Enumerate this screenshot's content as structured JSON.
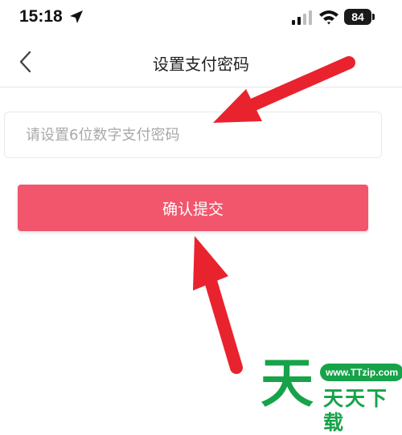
{
  "status_bar": {
    "time": "15:18",
    "battery": "84",
    "icons": [
      "location-arrow-icon",
      "cellular-signal-icon",
      "wifi-icon",
      "battery-icon"
    ]
  },
  "nav": {
    "back_icon": "chevron-left-icon",
    "title": "设置支付密码"
  },
  "form": {
    "password_placeholder": "请设置6位数字支付密码",
    "password_value": "",
    "submit_label": "确认提交"
  },
  "annotations": {
    "arrow_color": "#e8232e",
    "arrow_count": 2
  },
  "watermark": {
    "logo_char": "天",
    "url": "www.TTzip.com",
    "name": "天天下载",
    "color": "#16a34a"
  },
  "colors": {
    "accent": "#f2566c",
    "background": "#ffffff",
    "divider": "#e6e6e6"
  }
}
